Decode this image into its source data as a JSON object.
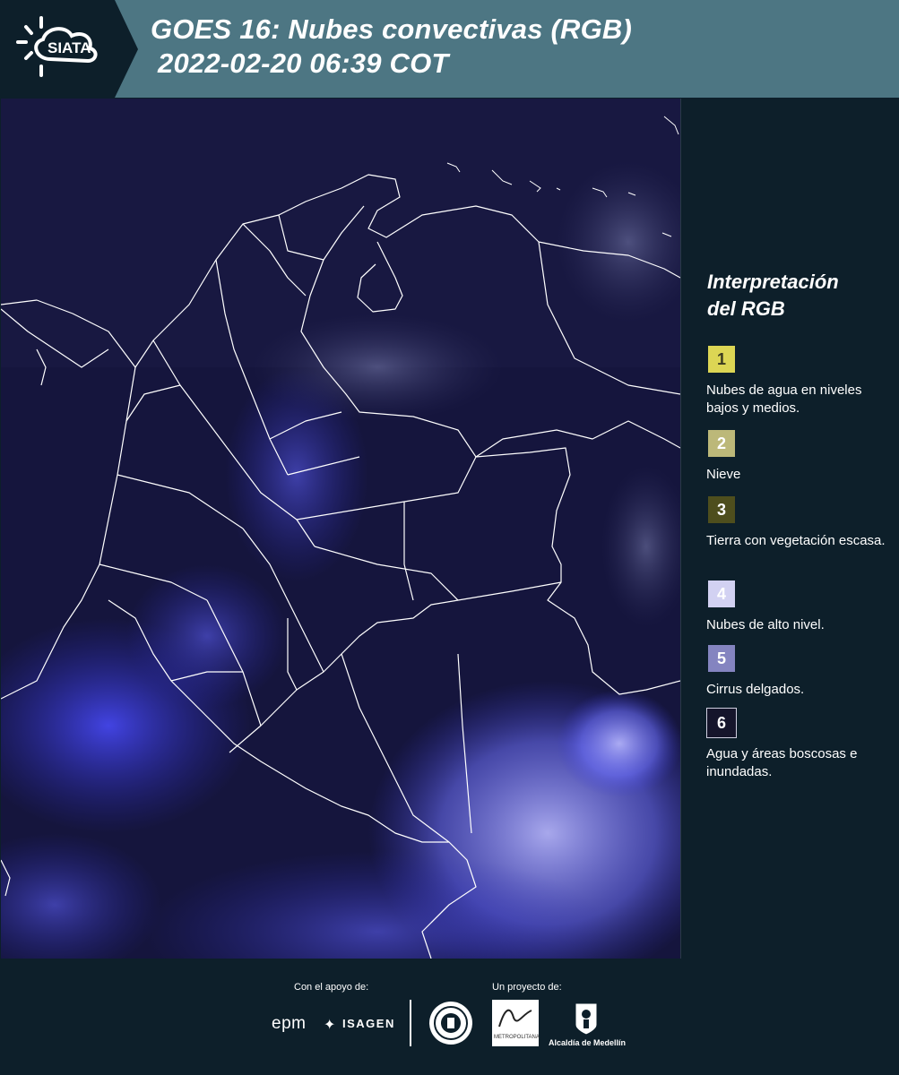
{
  "header": {
    "logo_text": "SIATA",
    "title_line1": "GOES 16: Nubes convectivas (RGB)",
    "title_line2": "2022-02-20 06:39 COT"
  },
  "legend": {
    "title_line1": "Interpretación",
    "title_line2": "del RGB",
    "items": [
      {
        "number": "1",
        "label": "Nubes de agua en niveles bajos y medios.",
        "color": "#dcd654",
        "text_color": "#3a3a20"
      },
      {
        "number": "2",
        "label": "Nieve",
        "color": "#bcb879",
        "text_color": "#ffffff"
      },
      {
        "number": "3",
        "label": "Tierra con vegetación escasa.",
        "color": "#4e4e1d",
        "text_color": "#ffffff"
      },
      {
        "number": "4",
        "label": "Nubes de alto nivel.",
        "color": "#d2d1f2",
        "text_color": "#ffffff"
      },
      {
        "number": "5",
        "label": "Cirrus delgados.",
        "color": "#8484c0",
        "text_color": "#ffffff"
      },
      {
        "number": "6",
        "label": "Agua y áreas boscosas e inundadas.",
        "color": "#15152b",
        "text_color": "#ffffff",
        "border": "#cfcfe0"
      }
    ]
  },
  "footer": {
    "support_label": "Con el apoyo de:",
    "project_label": "Un proyecto de:",
    "sponsors": [
      "epm",
      "ISAGEN"
    ],
    "area_caption": "METROPOLITANA",
    "alcaldia_label": "Alcaldía de Medellín"
  },
  "colors": {
    "header_bg": "#4d7683",
    "page_bg": "#0d1f2a",
    "map_bg": "#14143a",
    "boundary": "#ffffff"
  }
}
